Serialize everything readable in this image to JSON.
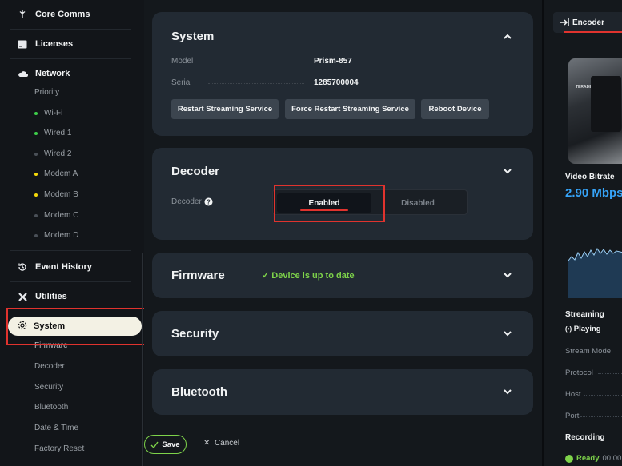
{
  "sidebar": {
    "nav": [
      {
        "label": "Core Comms",
        "icon": "antenna-icon"
      },
      {
        "label": "Licenses",
        "icon": "license-icon"
      },
      {
        "label": "Network",
        "icon": "cloud-icon"
      }
    ],
    "network_items": [
      {
        "label": "Priority",
        "status": "none"
      },
      {
        "label": "Wi-Fi",
        "status": "green"
      },
      {
        "label": "Wired 1",
        "status": "green"
      },
      {
        "label": "Wired 2",
        "status": "grey"
      },
      {
        "label": "Modem A",
        "status": "yellow"
      },
      {
        "label": "Modem B",
        "status": "yellow"
      },
      {
        "label": "Modem C",
        "status": "grey"
      },
      {
        "label": "Modem D",
        "status": "grey"
      }
    ],
    "event_history": "Event History",
    "utilities": "Utilities",
    "system": "System",
    "system_items": [
      "Firmware",
      "Decoder",
      "Security",
      "Bluetooth",
      "Date & Time",
      "Factory Reset"
    ]
  },
  "system_card": {
    "title": "System",
    "model_label": "Model",
    "model_value": "Prism-857",
    "serial_label": "Serial",
    "serial_value": "1285700004",
    "buttons": [
      "Restart Streaming Service",
      "Force Restart Streaming Service",
      "Reboot Device"
    ]
  },
  "decoder_card": {
    "title": "Decoder",
    "label": "Decoder",
    "enabled_label": "Enabled",
    "disabled_label": "Disabled",
    "selected": "Enabled"
  },
  "firmware_card": {
    "title": "Firmware",
    "status": "Device is up to date"
  },
  "security_card": {
    "title": "Security"
  },
  "bluetooth_card": {
    "title": "Bluetooth"
  },
  "footer": {
    "save": "Save",
    "cancel": "Cancel"
  },
  "right_panel": {
    "tab": "Encoder",
    "video_bitrate_label": "Video Bitrate",
    "video_bitrate_value": "2.90 Mbps",
    "streaming_label": "Streaming",
    "streaming_status": "Playing",
    "stream_mode_label": "Stream Mode",
    "protocol_label": "Protocol",
    "host_label": "Host",
    "port_label": "Port",
    "recording_label": "Recording",
    "recording_status": "Ready",
    "recording_time": "00:00",
    "thumb_text": "TERADEK"
  },
  "colors": {
    "accent_red": "#e0332e",
    "ok_green": "#7ed34a",
    "bitrate_blue": "#36a3f7",
    "warn_yellow": "#f5d90a"
  }
}
